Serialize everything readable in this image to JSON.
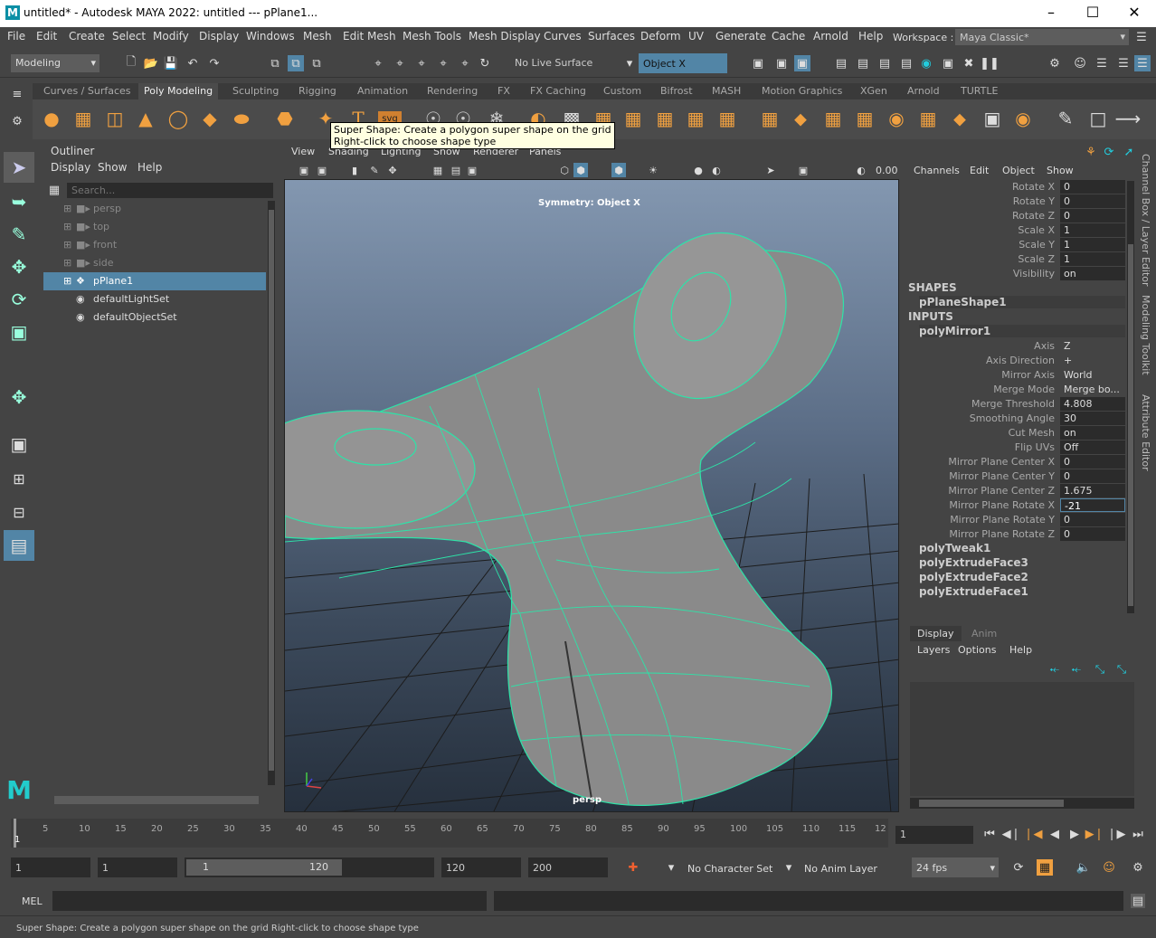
{
  "window": {
    "title": "untitled* - Autodesk MAYA 2022: untitled   ---   pPlane1...",
    "logo": "M"
  },
  "menu": [
    "File",
    "Edit",
    "Create",
    "Select",
    "Modify",
    "Display",
    "Windows",
    "Mesh",
    "Edit Mesh",
    "Mesh Tools",
    "Mesh Display",
    "Curves",
    "Surfaces",
    "Deform",
    "UV",
    "Generate",
    "Cache",
    "Arnold",
    "Help"
  ],
  "workspace": {
    "label": "Workspace :",
    "value": "Maya Classic*"
  },
  "status": {
    "menuset": "Modeling",
    "live_surface": "No Live Surface",
    "symmetry": "Object X"
  },
  "shelf_tabs": [
    "Curves / Surfaces",
    "Poly Modeling",
    "Sculpting",
    "Rigging",
    "Animation",
    "Rendering",
    "FX",
    "FX Caching",
    "Custom",
    "Bifrost",
    "MASH",
    "Motion Graphics",
    "XGen",
    "Arnold",
    "TURTLE"
  ],
  "shelf_active": "Poly Modeling",
  "shelf_text_icons": {
    "text": "T",
    "svg": "svg"
  },
  "tooltip": {
    "line1": "Super Shape: Create a polygon super shape on the grid",
    "line2": "Right-click to choose shape type"
  },
  "outliner": {
    "title": "Outliner",
    "menus": [
      "Display",
      "Show",
      "Help"
    ],
    "search_placeholder": "Search...",
    "items": [
      {
        "label": "persp",
        "dim": true
      },
      {
        "label": "top",
        "dim": true
      },
      {
        "label": "front",
        "dim": true
      },
      {
        "label": "side",
        "dim": true
      },
      {
        "label": "pPlane1",
        "selected": true
      },
      {
        "label": "defaultLightSet"
      },
      {
        "label": "defaultObjectSet"
      }
    ]
  },
  "viewport": {
    "menus": [
      "View",
      "Shading",
      "Lighting",
      "Show",
      "Renderer",
      "Panels"
    ],
    "symmetry_label": "Symmetry: Object X",
    "camera_label": "persp",
    "exposure": "0.00"
  },
  "channelbox": {
    "menus": [
      "Channels",
      "Edit",
      "Object",
      "Show"
    ],
    "transform": [
      {
        "label": "Rotate X",
        "value": "0"
      },
      {
        "label": "Rotate Y",
        "value": "0"
      },
      {
        "label": "Rotate Z",
        "value": "0"
      },
      {
        "label": "Scale X",
        "value": "1"
      },
      {
        "label": "Scale Y",
        "value": "1"
      },
      {
        "label": "Scale Z",
        "value": "1"
      },
      {
        "label": "Visibility",
        "value": "on"
      }
    ],
    "shapes_header": "SHAPES",
    "shape_node": "pPlaneShape1",
    "inputs_header": "INPUTS",
    "input_node": "polyMirror1",
    "mirror_attrs": [
      {
        "label": "Axis",
        "value": "Z"
      },
      {
        "label": "Axis Direction",
        "value": "+"
      },
      {
        "label": "Mirror Axis",
        "value": "World"
      },
      {
        "label": "Merge Mode",
        "value": "Merge bo..."
      },
      {
        "label": "Merge Threshold",
        "value": "4.808"
      },
      {
        "label": "Smoothing Angle",
        "value": "30"
      },
      {
        "label": "Cut Mesh",
        "value": "on"
      },
      {
        "label": "Flip UVs",
        "value": "Off"
      },
      {
        "label": "Mirror Plane Center X",
        "value": "0"
      },
      {
        "label": "Mirror Plane Center Y",
        "value": "0"
      },
      {
        "label": "Mirror Plane Center Z",
        "value": "1.675"
      },
      {
        "label": "Mirror Plane Rotate X",
        "value": "-21"
      },
      {
        "label": "Mirror Plane Rotate Y",
        "value": "0"
      },
      {
        "label": "Mirror Plane Rotate Z",
        "value": "0"
      }
    ],
    "other_inputs": [
      "polyTweak1",
      "polyExtrudeFace3",
      "polyExtrudeFace2",
      "polyExtrudeFace1"
    ]
  },
  "layer_editor": {
    "tabs": [
      "Display",
      "Anim"
    ],
    "menus": [
      "Layers",
      "Options",
      "Help"
    ]
  },
  "side_tabs": [
    "Channel Box / Layer Editor",
    "Modeling Toolkit",
    "Attribute Editor"
  ],
  "timeline": {
    "ticks": [
      "5",
      "10",
      "15",
      "20",
      "25",
      "30",
      "35",
      "40",
      "45",
      "50",
      "55",
      "60",
      "65",
      "70",
      "75",
      "80",
      "85",
      "90",
      "95",
      "100",
      "105",
      "110",
      "115",
      "12"
    ],
    "current_frame": "1",
    "marker_left": "1"
  },
  "range": {
    "start": "1",
    "playback_start": "1",
    "slider_start": "1",
    "slider_end": "120",
    "playback_end": "120",
    "end": "200",
    "character_set": "No Character Set",
    "anim_layer": "No Anim Layer",
    "fps": "24 fps"
  },
  "command": {
    "lang": "MEL"
  },
  "help_line": "Super Shape: Create a polygon super shape on the grid Right-click to choose shape type"
}
